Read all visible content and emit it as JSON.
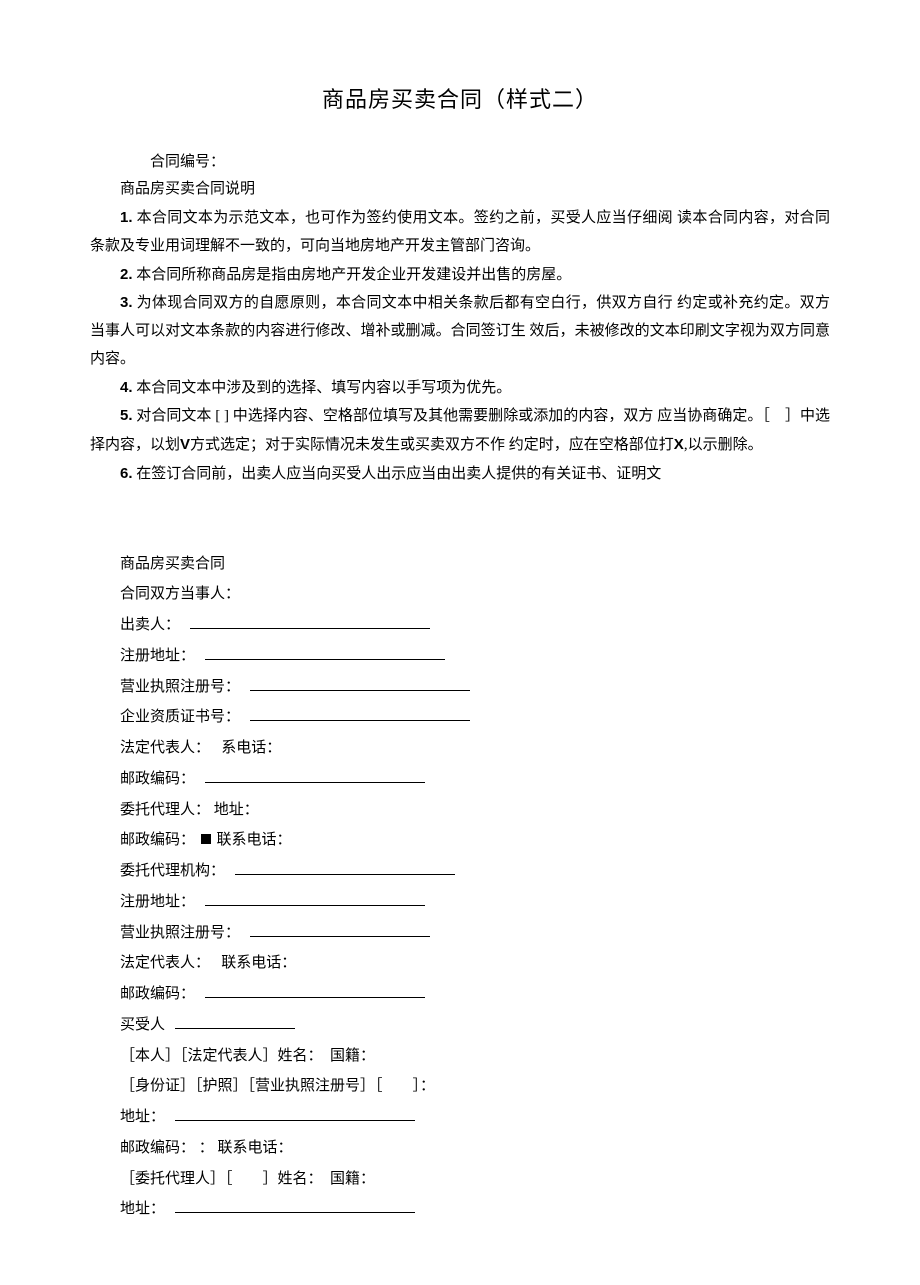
{
  "title": "商品房买卖合同（样式二）",
  "contract_no_label": "合同编号：",
  "explain_header": "商品房买卖合同说明",
  "items": {
    "n1": "1.",
    "t1": "本合同文本为示范文本，也可作为签约使用文本。签约之前，买受人应当仔细阅 读本合同内容，对合同条款及专业用词理解不一致的，可向当地房地产开发主管部门咨询。",
    "n2": "2.",
    "t2": "本合同所称商品房是指由房地产开发企业开发建设并出售的房屋。",
    "n3": "3.",
    "t3": "为体现合同双方的自愿原则，本合同文本中相关条款后都有空白行，供双方自行 约定或补充约定。双方当事人可以对文本条款的内容进行修改、增补或删减。合同签订生 效后，未被修改的文本印刷文字视为双方同意内容。",
    "n4": "4.",
    "t4": "本合同文本中涉及到的选择、填写内容以手写项为优先。",
    "n5": "5.",
    "t5a": "对合同文本 [ ] 中选择内容、空格部位填写及其他需要删除或添加的内容，双方 应当协商确定。［　］中选择内容，以划",
    "t5v": "V",
    "t5b": "方式选定；对于实际情况未发生或买卖双方不作 约定时，应在空格部位打",
    "t5x": "X",
    "t5c": ",以示删除。",
    "n6": "6.",
    "t6": "在签订合同前，出卖人应当向买受人出示应当由出卖人提供的有关证书、证明文"
  },
  "form": {
    "header": "商品房买卖合同",
    "parties": "合同双方当事人：",
    "seller": "出卖人：",
    "reg_addr": "注册地址：",
    "biz_reg_no": "营业执照注册号：",
    "ent_qual_no": "企业资质证书号：",
    "legal_rep": "法定代表人：",
    "tel_suffix": "系电话：",
    "postal": "邮政编码：",
    "agent_person": "委托代理人：",
    "addr": "地址：",
    "contact_tel": "联系电话：",
    "agent_org": "委托代理机构：",
    "buyer": "买受人",
    "self_legal": "［本人］［法定代表人］姓名：　国籍：",
    "id_line": "［身份证］［护照］［营业执照注册号］［　　］：",
    "agent_line": "［委托代理人］［　　］姓名：　国籍：",
    "colon": "："
  }
}
